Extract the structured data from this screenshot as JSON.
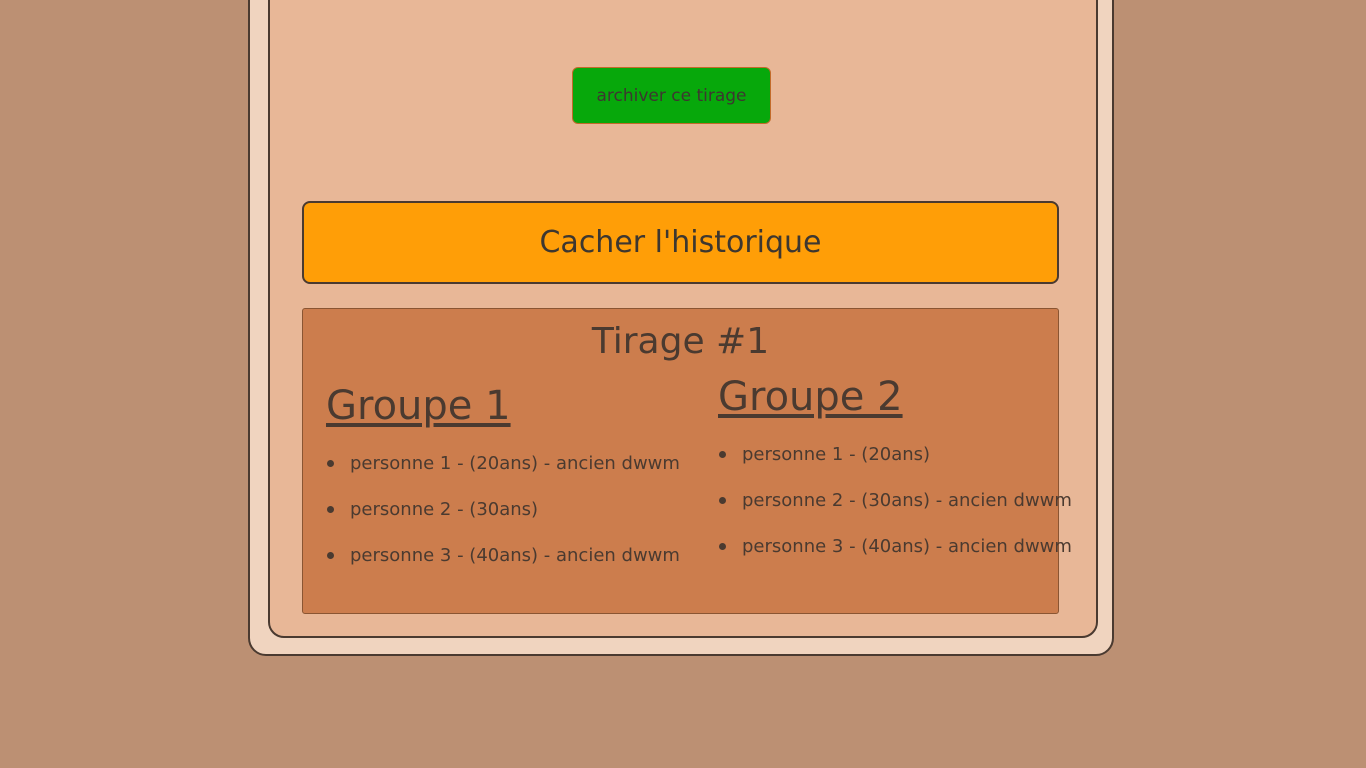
{
  "archive_button": {
    "label": "archiver ce tirage"
  },
  "history_button": {
    "label": "Cacher l'historique"
  },
  "draw": {
    "title": "Tirage #1",
    "groups": [
      {
        "title": "Groupe 1",
        "members": [
          "personne 1 - (20ans) - ancien dwwm",
          "personne 2 - (30ans)",
          "personne 3 - (40ans) - ancien dwwm"
        ]
      },
      {
        "title": "Groupe 2",
        "members": [
          "personne 1 - (20ans)",
          "personne 2 - (30ans) - ancien dwwm",
          "personne 3 - (40ans) - ancien dwwm"
        ]
      }
    ]
  },
  "colors": {
    "page_background": "#bc9073",
    "outer_card": "#f0d4bf",
    "inner_card": "#e8b797",
    "archive_button": "#07a80b",
    "history_button": "#ff9e07",
    "draw_panel": "#cc7d4d",
    "text": "#4a3a30"
  }
}
